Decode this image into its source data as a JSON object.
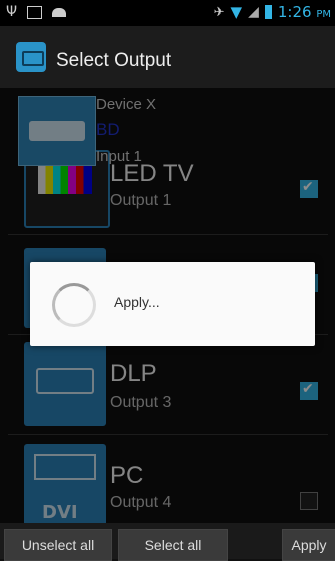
{
  "status_bar": {
    "time": "1:26",
    "ampm": "PM"
  },
  "action_bar": {
    "title": "Select Output"
  },
  "source": {
    "name": "Device X",
    "type": "BD",
    "input": "Input 1"
  },
  "outputs": [
    {
      "name": "LED TV",
      "sub": "Output 1",
      "checked": true
    },
    {
      "name": "",
      "sub": "",
      "checked": true
    },
    {
      "name": "DLP",
      "sub": "Output 3",
      "checked": true
    },
    {
      "name": "PC",
      "sub": "Output 4",
      "checked": false
    }
  ],
  "dialog": {
    "text": "Apply..."
  },
  "bottom_buttons": {
    "unselect_all": "Unselect all",
    "select_all": "Select all",
    "apply": "Apply"
  },
  "colors": {
    "accent": "#33b5e5",
    "tile": "#2b82b8",
    "source_type": "#2233cc"
  }
}
